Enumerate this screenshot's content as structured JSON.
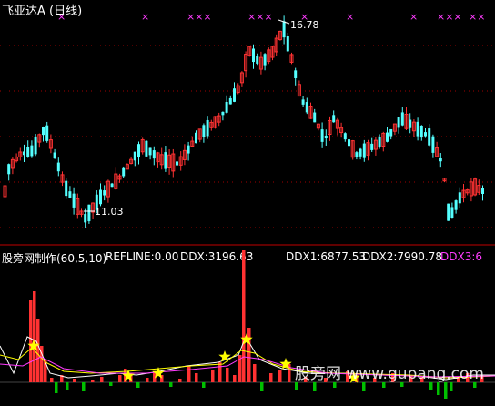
{
  "title": "飞亚达A (日线)",
  "indicator": {
    "name_params": "股旁网制作(60,5,10)",
    "refline": "REFLINE:0.00",
    "ddx": "DDX:3196.63",
    "ddx1": "DDX1:6877.53",
    "ddx2": "DDX2:7990.78",
    "ddx3": "DDX3:6"
  },
  "watermark": "股旁网 www.gupang.com",
  "colors": {
    "background": "#000000",
    "up": "#ff3232",
    "down": "#54ffff",
    "marker": "#ff3cff",
    "star": "#ffff00",
    "grid": "#a00000",
    "bar_negative": "#00c000"
  },
  "chart_data": [
    {
      "type": "candlestick",
      "title": "飞亚达A (日线)",
      "annotations": [
        {
          "label": "16.78",
          "role": "high"
        },
        {
          "label": "11.03",
          "role": "low"
        }
      ],
      "top_markers": [
        "×",
        "×",
        "×××",
        "×××",
        "×",
        "××",
        "×",
        "×××",
        "×",
        "××"
      ]
    },
    {
      "type": "bar+line",
      "title": "股旁网制作(60,5,10)",
      "series": [
        {
          "name": "DDX",
          "value": 3196.63
        },
        {
          "name": "DDX1",
          "value": 6877.53
        },
        {
          "name": "DDX2",
          "value": 7990.78
        },
        {
          "name": "DDX3",
          "value": 6
        }
      ]
    }
  ]
}
